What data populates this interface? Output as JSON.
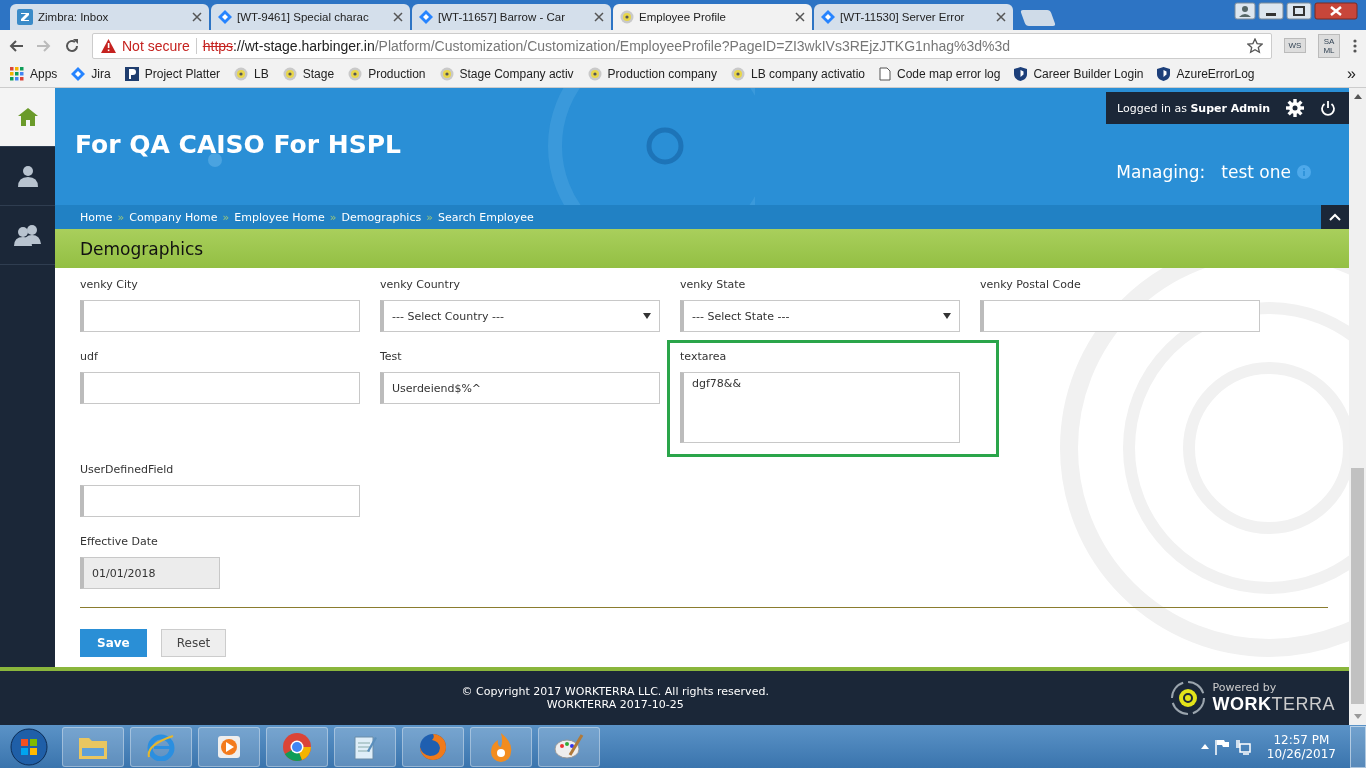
{
  "browser": {
    "tabs": [
      {
        "title": "Zimbra: Inbox",
        "kind": "zimbra",
        "selected": false
      },
      {
        "title": "[WT-9461] Special charac",
        "kind": "jira",
        "selected": false
      },
      {
        "title": "[WT-11657] Barrow - Car",
        "kind": "jira",
        "selected": false
      },
      {
        "title": "Employee Profile",
        "kind": "globe",
        "selected": true
      },
      {
        "title": "[WT-11530] Server Error",
        "kind": "jira",
        "selected": false
      }
    ],
    "address": {
      "security": "Not secure",
      "scheme": "https",
      "host": "://wt-stage.harbinger.in",
      "path": "/Platform/Customization/Customization/EmployeeProfile?PageID=ZI3wkIVs3REjzJTKG1nhag%3d%3d"
    },
    "extensions": [
      "WS",
      "SA ML"
    ],
    "bookmarks": [
      {
        "label": "Apps",
        "kind": "apps"
      },
      {
        "label": "Jira",
        "kind": "jira"
      },
      {
        "label": "Project Platter",
        "kind": "p"
      },
      {
        "label": "LB",
        "kind": "globe"
      },
      {
        "label": "Stage",
        "kind": "globe"
      },
      {
        "label": "Production",
        "kind": "globe"
      },
      {
        "label": "Stage Company activ",
        "kind": "globe"
      },
      {
        "label": "Production company",
        "kind": "globe"
      },
      {
        "label": "LB company activatio",
        "kind": "globe"
      },
      {
        "label": "Code map error log",
        "kind": "doc"
      },
      {
        "label": "Career Builder Login",
        "kind": "shield"
      },
      {
        "label": "AzureErrorLog",
        "kind": "shield"
      }
    ],
    "bookmarks_more": "»"
  },
  "sidebar": [
    {
      "kind": "home",
      "selected": true
    },
    {
      "kind": "person",
      "selected": false
    },
    {
      "kind": "people",
      "selected": false
    }
  ],
  "header": {
    "title": "For QA CAISO For HSPL",
    "logged_in": "Logged in as **Super Admin**",
    "managing_label": "Managing:",
    "managing_value": "test one"
  },
  "breadcrumbs": [
    "Home",
    "Company Home",
    "Employee Home",
    "Demographics",
    "Search Employee"
  ],
  "breadcrumb_separator": "»",
  "section_title": "Demographics",
  "form_rows": [
    [
      {
        "label": "venky City",
        "kind": "text"
      },
      {
        "label": "venky Country",
        "kind": "select",
        "value": "--- Select Country ---"
      },
      {
        "label": "venky State",
        "kind": "select",
        "value": "--- Select State ---"
      },
      {
        "label": "venky Postal Code",
        "kind": "text"
      }
    ],
    [
      {
        "label": "udf",
        "kind": "text"
      },
      {
        "label": "Test",
        "kind": "text",
        "value": "Userdeiend$%^"
      },
      {
        "label": "textarea",
        "kind": "textarea",
        "value": "dgf78&&",
        "highlighted": true
      }
    ],
    [
      {
        "label": "UserDefinedField",
        "kind": "text"
      }
    ],
    [
      {
        "label": "Effective Date",
        "kind": "date",
        "value": "01/01/2018",
        "disabled": true
      }
    ]
  ],
  "buttons": [
    {
      "label": "Save",
      "kind": "primary"
    },
    {
      "label": "Reset",
      "kind": "secondary"
    }
  ],
  "footer": {
    "copyright": "© Copyright 2017 WORKTERRA LLC. All rights reserved.",
    "version": "WORKTERRA 2017-10-25",
    "powered_by": "Powered by",
    "brand": "**WORK**TERRA"
  },
  "taskbar": {
    "apps": [
      {
        "kind": "folder"
      },
      {
        "kind": "ie"
      },
      {
        "kind": "media"
      },
      {
        "kind": "chrome"
      },
      {
        "kind": "notepad"
      },
      {
        "kind": "firefox"
      },
      {
        "kind": "flame"
      },
      {
        "kind": "paint"
      }
    ],
    "time": "12:57 PM",
    "date": "10/26/2017"
  }
}
